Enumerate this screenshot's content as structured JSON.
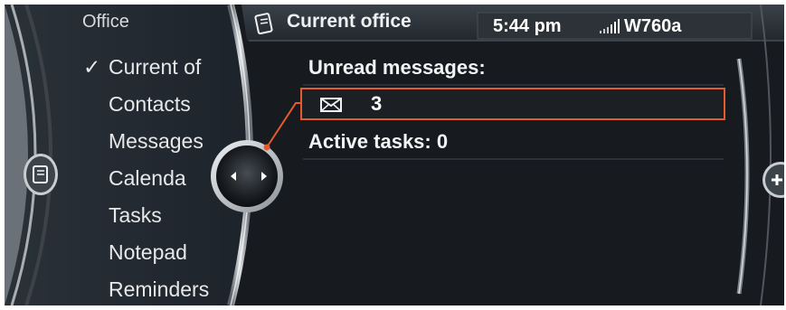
{
  "left_panel": {
    "title": "Office",
    "checkmark": "✓",
    "items": [
      "Current of",
      "Contacts",
      "Messages",
      "Calenda",
      "Tasks",
      "Notepad",
      "Reminders"
    ]
  },
  "header": {
    "title": "Current office",
    "title_icon": "notebook-icon",
    "time": "5:44 pm",
    "network": "W760a",
    "signal_icon": "signal-bars-icon"
  },
  "main": {
    "unread_label": "Unread messages:",
    "unread_icon": "envelope-icon",
    "unread_count": "3",
    "tasks_label": "Active tasks: 0"
  },
  "colors": {
    "screen_bg": "#16191d",
    "left_panel_bg": "#222a33",
    "highlight": "#e55b2d",
    "text": "#e6e8ea"
  }
}
